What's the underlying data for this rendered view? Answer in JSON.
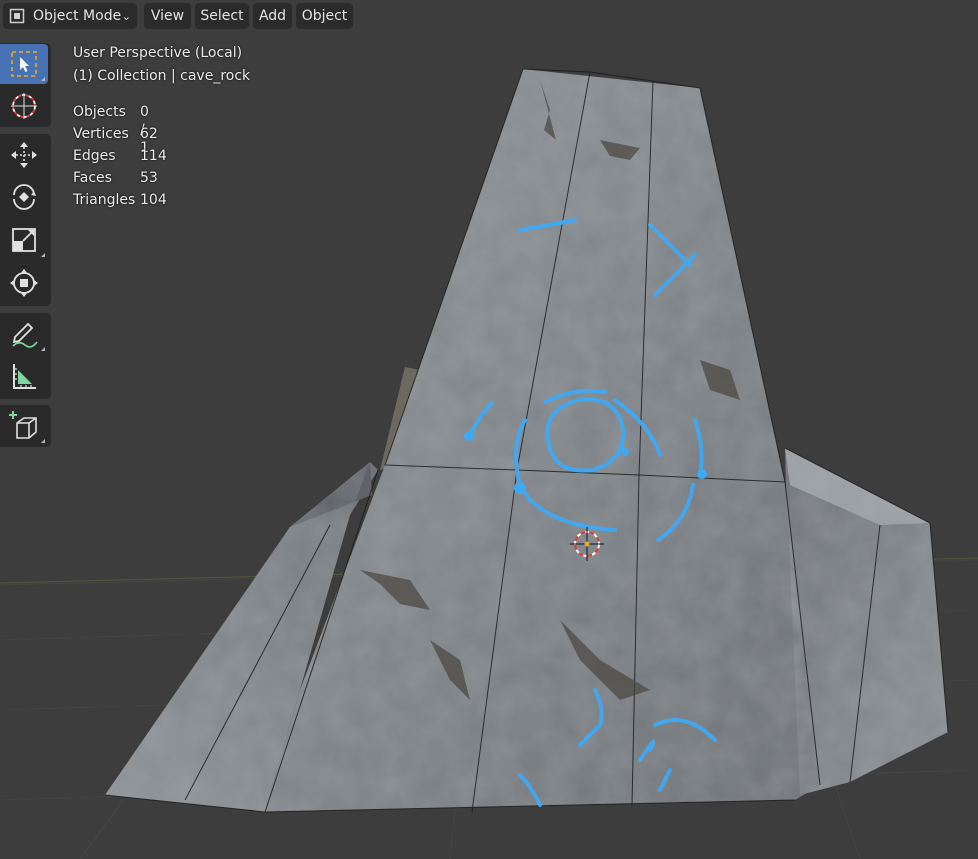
{
  "header": {
    "mode_label": "Object Mode",
    "menus": [
      "View",
      "Select",
      "Add",
      "Object"
    ]
  },
  "toolbar": {
    "tools": [
      {
        "name": "select-box",
        "icon": "select-box-icon",
        "active": true
      },
      {
        "name": "cursor",
        "icon": "cursor-icon",
        "active": false
      },
      {
        "name": "move",
        "icon": "move-icon",
        "active": false
      },
      {
        "name": "rotate",
        "icon": "rotate-icon",
        "active": false
      },
      {
        "name": "scale",
        "icon": "scale-icon",
        "active": false
      },
      {
        "name": "transform",
        "icon": "transform-icon",
        "active": false
      },
      {
        "name": "annotate",
        "icon": "annotate-icon",
        "active": false
      },
      {
        "name": "measure",
        "icon": "measure-icon",
        "active": false
      },
      {
        "name": "add-cube",
        "icon": "add-cube-icon",
        "active": false
      }
    ]
  },
  "viewport": {
    "perspective": "User Perspective (Local)",
    "collection": "(1) Collection | cave_rock",
    "stats": [
      {
        "label": "Objects",
        "value": "0 / 1"
      },
      {
        "label": "Vertices",
        "value": "62"
      },
      {
        "label": "Edges",
        "value": "114"
      },
      {
        "label": "Faces",
        "value": "53"
      },
      {
        "label": "Triangles",
        "value": "104"
      }
    ]
  },
  "colors": {
    "background": "#3d3d3d",
    "active_tool": "#4772b3",
    "glow": "#3fa9f5"
  }
}
